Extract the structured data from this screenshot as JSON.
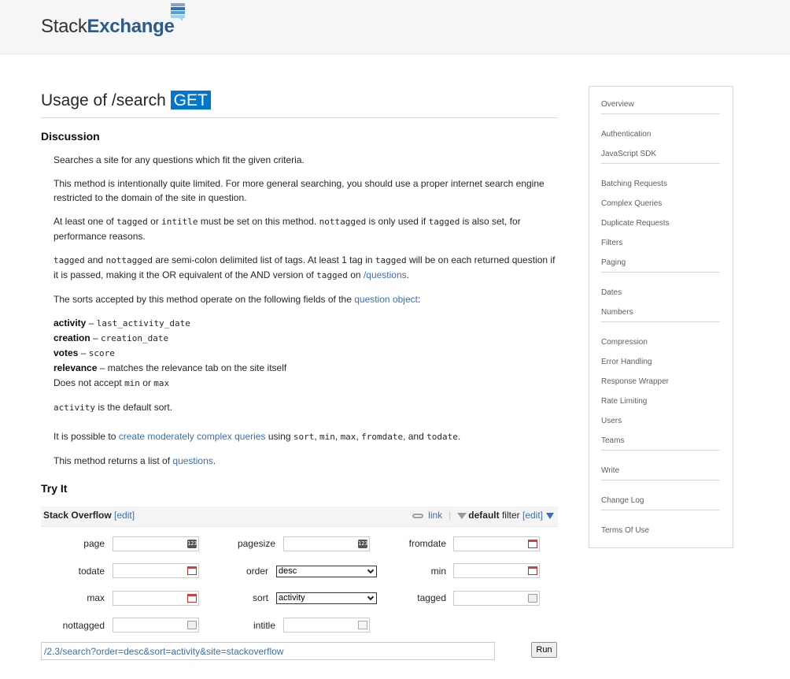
{
  "header": {
    "logo": {
      "stack": "Stack",
      "exchange": "Exchange"
    }
  },
  "title": {
    "path": "Usage of /search",
    "verb": "GET"
  },
  "discussion": {
    "heading": "Discussion",
    "p1": "Searches a site for any questions which fit the given criteria.",
    "p2": "This method is intentionally quite limited. For more general searching, you should use a proper internet search engine restricted to the domain of the site in question.",
    "p3": {
      "a": "At least one of ",
      "tagged": "tagged",
      "b": " or ",
      "intitle": "intitle",
      "c": " must be set on this method. ",
      "nottagged": "nottagged",
      "d": " is only used if ",
      "tagged2": "tagged",
      "e": " is also set, for performance reasons."
    },
    "p4": {
      "tagged": "tagged",
      "a": " and ",
      "nottagged": "nottagged",
      "b": " are semi-colon delimited list of tags. At least 1 tag in ",
      "tagged2": "tagged",
      "c": " will be on each returned question if it is passed, making it the OR equivalent of the AND version of ",
      "tagged3": "tagged",
      "d": " on ",
      "link": "/questions",
      "e": "."
    },
    "p5": {
      "a": "The sorts accepted by this method operate on the following fields of the ",
      "link": "question object",
      "b": ":"
    },
    "sorts": [
      {
        "name": "activity",
        "dash": " – ",
        "field": "last_activity_date"
      },
      {
        "name": "creation",
        "dash": " – ",
        "field": "creation_date"
      },
      {
        "name": "votes",
        "dash": " – ",
        "field": "score"
      },
      {
        "name": "relevance",
        "dash": " – ",
        "text": "matches the relevance tab on the site itself"
      }
    ],
    "sort_note": {
      "a": "Does not accept ",
      "min": "min",
      "b": " or ",
      "max": "max"
    },
    "p6": {
      "code": "activity",
      "text": " is the default sort."
    },
    "p7": {
      "a": "It is possible to ",
      "link": "create moderately complex queries",
      "b": " using ",
      "c1": "sort",
      "s1": ", ",
      "c2": "min",
      "s2": ", ",
      "c3": "max",
      "s3": ", ",
      "c4": "fromdate",
      "s4": ", and ",
      "c5": "todate",
      "s5": "."
    },
    "p8": {
      "a": "This method returns a list of ",
      "link": "questions",
      "b": "."
    }
  },
  "try_it": {
    "heading": "Try It",
    "site": "Stack Overflow",
    "site_edit": "[edit]",
    "link_label": "link",
    "separator": "|",
    "filter_label": "default",
    "filter_word": " filter ",
    "filter_edit": "[edit]",
    "fields": {
      "page": "page",
      "pagesize": "pagesize",
      "fromdate": "fromdate",
      "todate": "todate",
      "order": "order",
      "min": "min",
      "max": "max",
      "sort": "sort",
      "tagged": "tagged",
      "nottagged": "nottagged",
      "intitle": "intitle"
    },
    "order_value": "desc",
    "sort_value": "activity",
    "number_icon_text": "123",
    "url": "/2.3/search?order=desc&sort=activity&site=stackoverflow",
    "run_label": "Run"
  },
  "sidebar": {
    "groups": [
      [
        "Overview"
      ],
      [
        "Authentication",
        "JavaScript SDK"
      ],
      [
        "Batching Requests",
        "Complex Queries",
        "Duplicate Requests",
        "Filters",
        "Paging"
      ],
      [
        "Dates",
        "Numbers"
      ],
      [
        "Compression",
        "Error Handling",
        "Response Wrapper",
        "Rate Limiting",
        "Users",
        "Teams"
      ],
      [
        "Write"
      ],
      [
        "Change Log"
      ],
      [
        "Terms Of Use"
      ]
    ]
  }
}
